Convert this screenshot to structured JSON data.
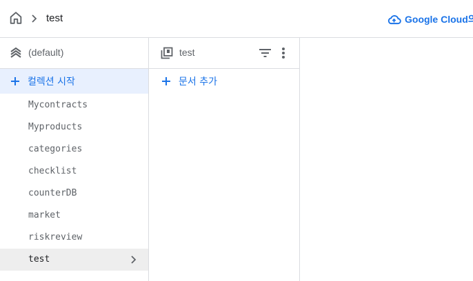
{
  "breadcrumb": {
    "home_icon": "home-icon",
    "separator_icon": "chevron-right-icon",
    "current": "test"
  },
  "cloud_link": {
    "icon": "cloud-icon",
    "label": "Google Cloud의"
  },
  "database_column": {
    "icon": "database-stack-icon",
    "label": "(default)",
    "start_collection_label": "컬렉션 시작",
    "collections": [
      "Mycontracts",
      "Myproducts",
      "categories",
      "checklist",
      "counterDB",
      "market",
      "riskreview",
      "test"
    ],
    "selected": "test"
  },
  "collection_column": {
    "icon": "collection-icon",
    "label": "test",
    "filter_icon": "filter-icon",
    "more_icon": "more-vert-icon",
    "add_document_label": "문서 추가"
  },
  "colors": {
    "accent": "#1a73e8",
    "selected_bg": "#eeeeee",
    "active_bg": "#e8f0fe",
    "divider": "#dadce0"
  }
}
